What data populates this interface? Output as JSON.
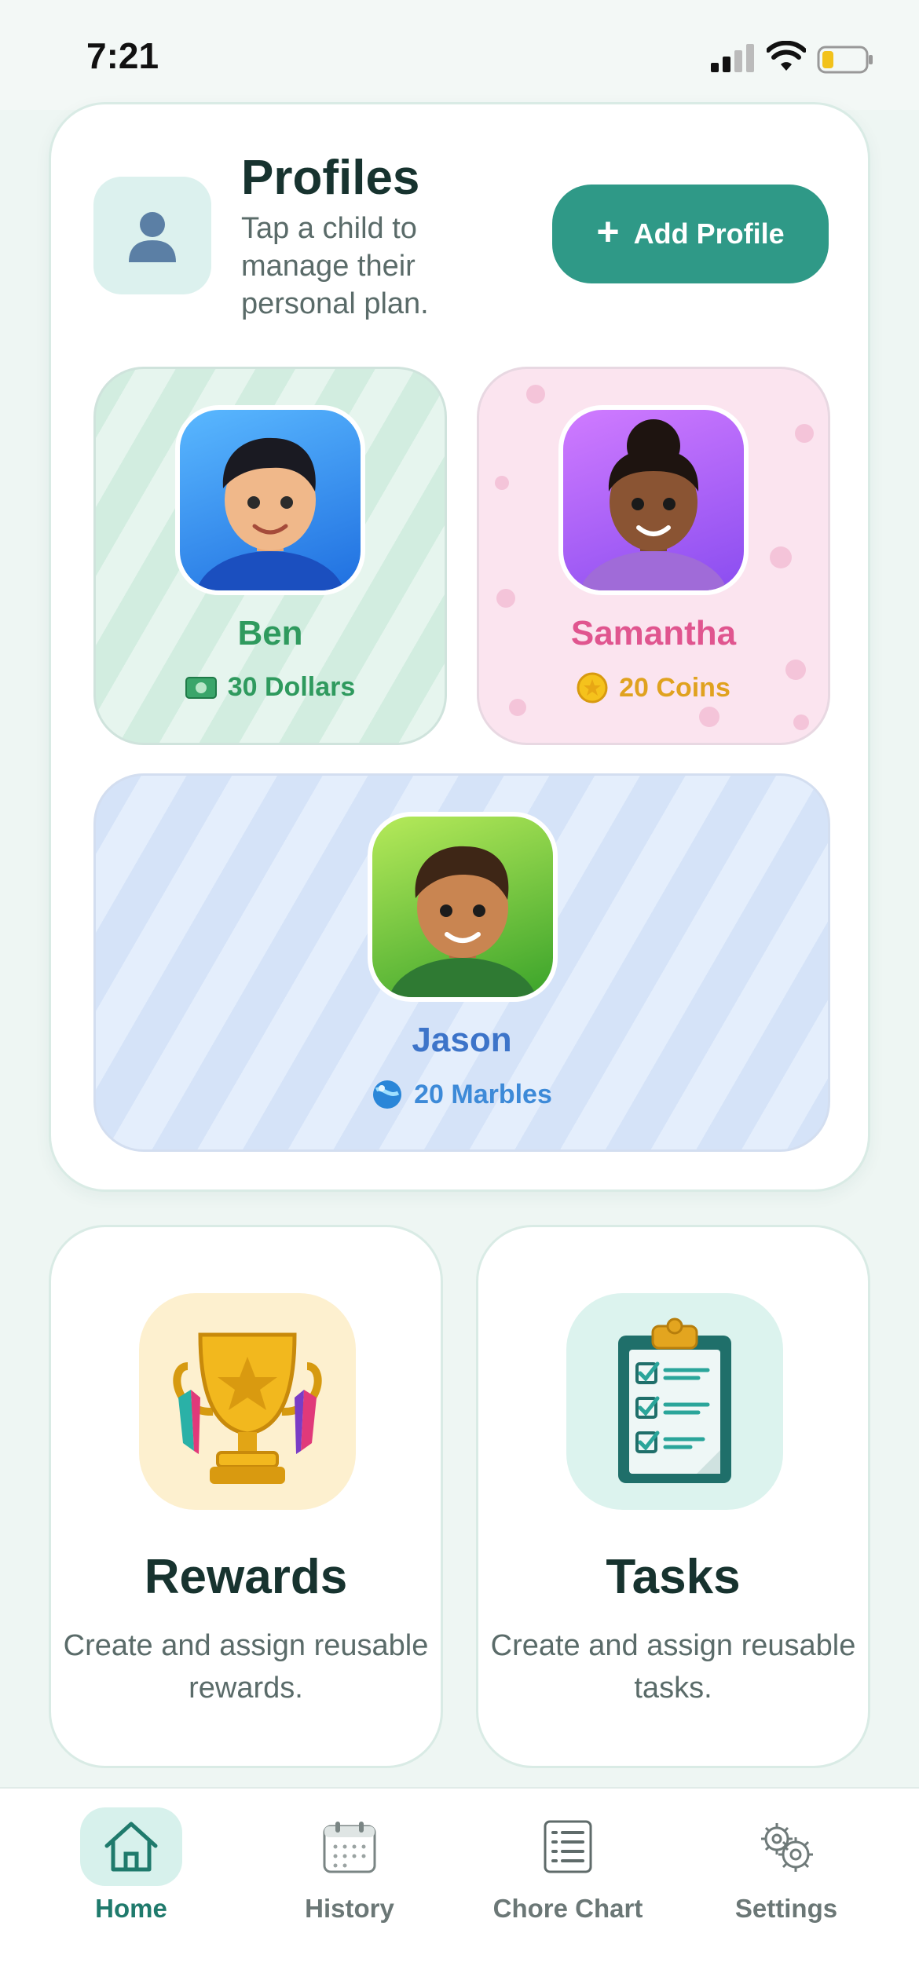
{
  "status": {
    "time": "7:21"
  },
  "profiles": {
    "title": "Profiles",
    "subtitle": "Tap a child to manage their personal plan.",
    "add_button": "Add Profile",
    "kids": [
      {
        "name": "Ben",
        "balance": "30 Dollars",
        "currency_icon": "dollar-bill-icon",
        "name_color": "#2f9a5e"
      },
      {
        "name": "Samantha",
        "balance": "20 Coins",
        "currency_icon": "coin-icon",
        "name_color": "#e0558f"
      },
      {
        "name": "Jason",
        "balance": "20 Marbles",
        "currency_icon": "marble-icon",
        "name_color": "#3d74c9"
      }
    ]
  },
  "features": [
    {
      "title": "Rewards",
      "desc": "Create and assign reusable rewards.",
      "icon": "trophy-icon"
    },
    {
      "title": "Tasks",
      "desc": "Create and assign reusable tasks.",
      "icon": "clipboard-checklist-icon"
    }
  ],
  "tabbar": {
    "tabs": [
      {
        "label": "Home",
        "icon": "home-icon",
        "active": true
      },
      {
        "label": "History",
        "icon": "calendar-icon",
        "active": false
      },
      {
        "label": "Chore Chart",
        "icon": "list-icon",
        "active": false
      },
      {
        "label": "Settings",
        "icon": "gear-icon",
        "active": false
      }
    ]
  },
  "colors": {
    "accent": "#2f9987",
    "background": "#eef6f3"
  }
}
